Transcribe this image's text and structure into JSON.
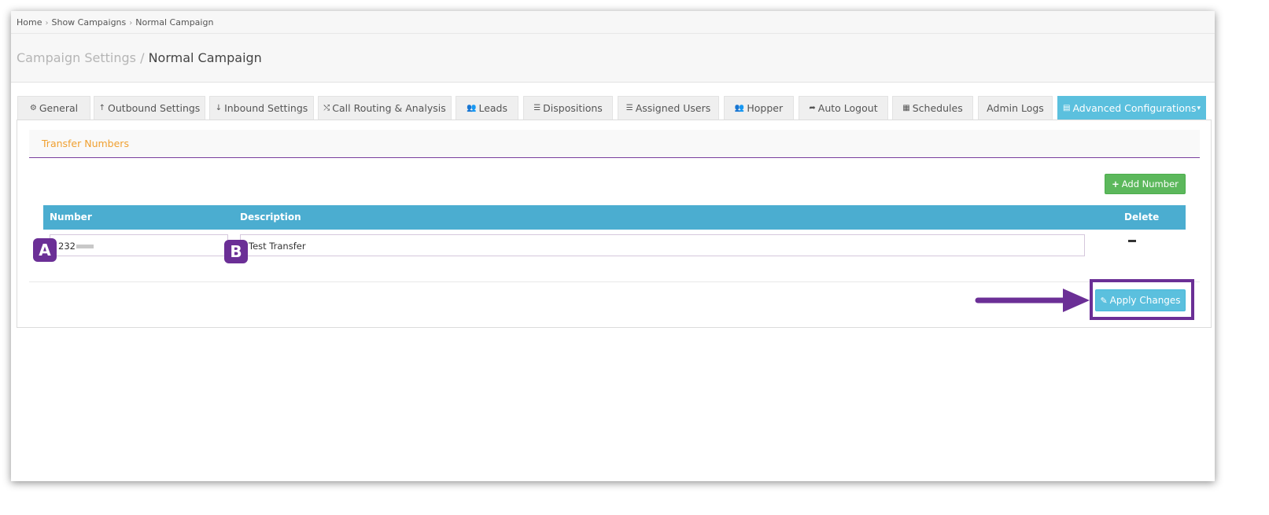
{
  "breadcrumb": {
    "home": "Home",
    "campaigns": "Show Campaigns",
    "current": "Normal Campaign"
  },
  "title": {
    "section": "Campaign Settings",
    "separator": "/",
    "campaign": "Normal Campaign"
  },
  "tabs": [
    {
      "label": "General",
      "icon": "cogs-icon",
      "glyph": "⚙"
    },
    {
      "label": "Outbound Settings",
      "icon": "arrow-up-icon",
      "glyph": "↑"
    },
    {
      "label": "Inbound Settings",
      "icon": "arrow-down-icon",
      "glyph": "↓"
    },
    {
      "label": "Call Routing & Analysis",
      "icon": "random-icon",
      "glyph": "⤭"
    },
    {
      "label": "Leads",
      "icon": "users-icon",
      "glyph": "👥"
    },
    {
      "label": "Dispositions",
      "icon": "list-icon",
      "glyph": "☰"
    },
    {
      "label": "Assigned Users",
      "icon": "ordered-list-icon",
      "glyph": "☰"
    },
    {
      "label": "Hopper",
      "icon": "users-icon",
      "glyph": "👥"
    },
    {
      "label": "Auto Logout",
      "icon": "sign-out-icon",
      "glyph": "➦"
    },
    {
      "label": "Schedules",
      "icon": "calendar-icon",
      "glyph": "▦"
    },
    {
      "label": "Admin Logs",
      "icon": "",
      "glyph": ""
    },
    {
      "label": "Advanced Configurations",
      "icon": "server-icon",
      "glyph": "▤",
      "caret": "▾",
      "active": true
    }
  ],
  "section": {
    "heading": "Transfer Numbers"
  },
  "buttons": {
    "add_number": "Add Number",
    "add_icon": "plus-icon",
    "apply": "Apply Changes",
    "apply_icon": "edit-icon"
  },
  "table": {
    "headers": {
      "number": "Number",
      "description": "Description",
      "delete": "Delete"
    },
    "rows": [
      {
        "number": "232",
        "description": "Test Transfer"
      }
    ]
  },
  "annotations": {
    "a": "A",
    "b": "B",
    "highlight_color": "#6b2f96"
  },
  "colors": {
    "accent": "#5bc0de",
    "success": "#5cb85c",
    "table_header": "#4badd0",
    "section_text": "#f0a030"
  }
}
